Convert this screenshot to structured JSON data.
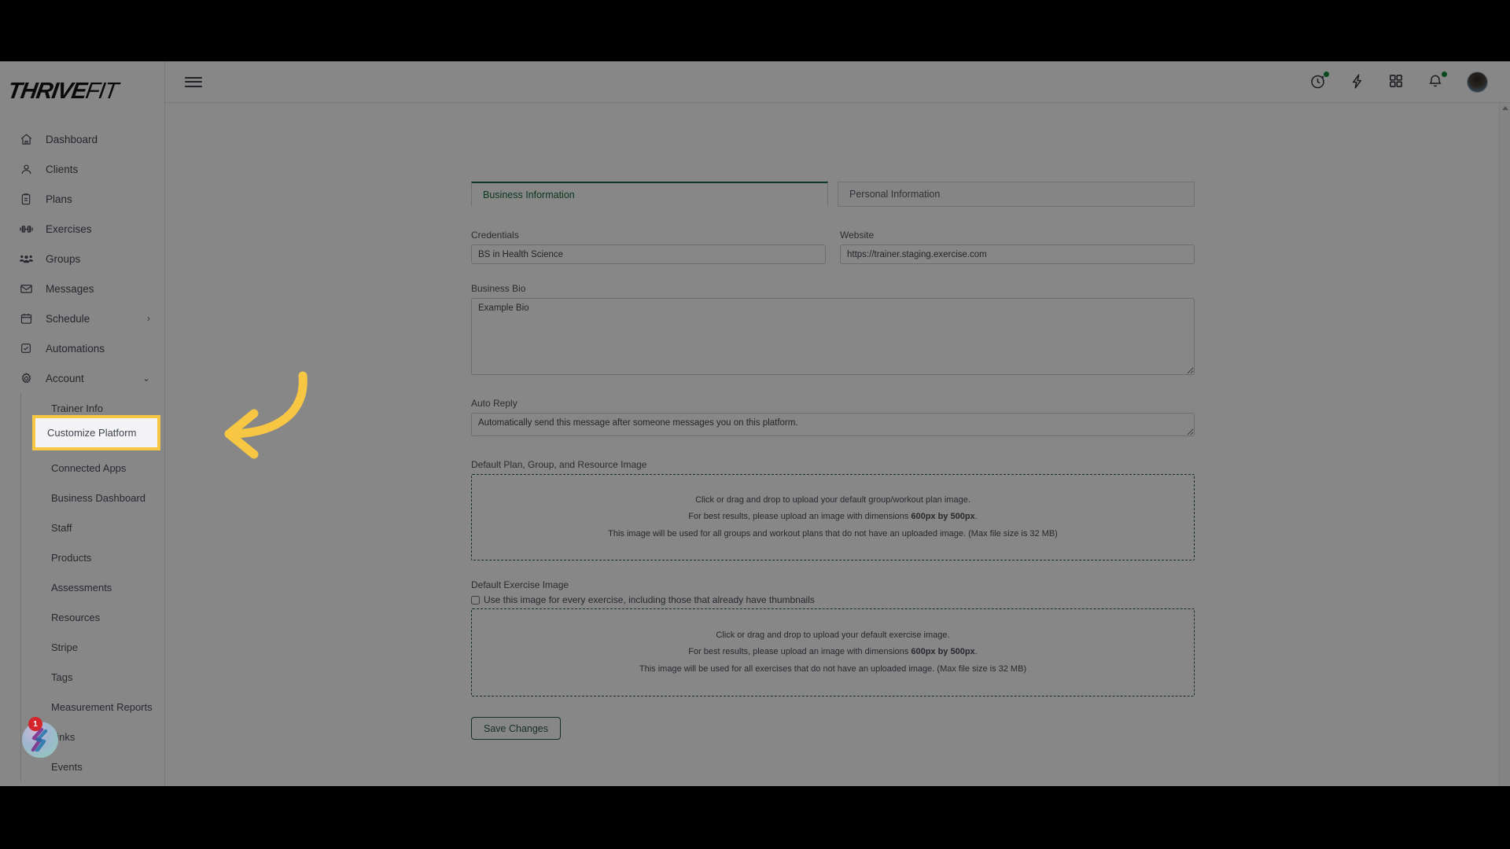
{
  "brand": {
    "name_bold": "THRIVE",
    "name_thin": "FIT"
  },
  "topbar": {
    "menu_icon": "hamburger-icon",
    "icons": [
      {
        "name": "activity-timer-icon",
        "has_dot": true
      },
      {
        "name": "lightning-bolt-icon",
        "has_dot": false
      },
      {
        "name": "apps-grid-icon",
        "has_dot": false
      },
      {
        "name": "notification-bell-icon",
        "has_dot": true
      }
    ],
    "avatar_name": "user-avatar"
  },
  "sidebar": {
    "items": [
      {
        "label": "Dashboard",
        "icon": "home-icon"
      },
      {
        "label": "Clients",
        "icon": "user-icon"
      },
      {
        "label": "Plans",
        "icon": "clipboard-icon"
      },
      {
        "label": "Exercises",
        "icon": "dumbbell-icon"
      },
      {
        "label": "Groups",
        "icon": "group-icon"
      },
      {
        "label": "Messages",
        "icon": "envelope-icon"
      },
      {
        "label": "Schedule",
        "icon": "calendar-icon",
        "chevron": "›"
      },
      {
        "label": "Automations",
        "icon": "checkbox-icon"
      },
      {
        "label": "Account",
        "icon": "gear-icon",
        "chevron": "⌄"
      }
    ],
    "account_subitems": [
      {
        "label": "Trainer Info"
      },
      {
        "label": "Customize Platform",
        "highlighted": true
      },
      {
        "label": "Connected Apps"
      },
      {
        "label": "Business Dashboard"
      },
      {
        "label": "Staff"
      },
      {
        "label": "Products"
      },
      {
        "label": "Assessments"
      },
      {
        "label": "Resources"
      },
      {
        "label": "Stripe"
      },
      {
        "label": "Tags"
      },
      {
        "label": "Measurement Reports"
      },
      {
        "label": "Links"
      },
      {
        "label": "Events"
      }
    ],
    "chat_widget": {
      "name": "chat-widget",
      "badge_count": "1"
    }
  },
  "main": {
    "tabs": [
      {
        "label": "Business Information",
        "active": true
      },
      {
        "label": "Personal Information",
        "active": false
      }
    ],
    "credentials": {
      "label": "Credentials",
      "value": "BS in Health Science",
      "placeholder": "Credentials"
    },
    "website": {
      "label": "Website",
      "value": "https://trainer.staging.exercise.com",
      "placeholder": "Website"
    },
    "business_bio": {
      "label": "Business Bio",
      "value": "Example Bio",
      "placeholder": "Business Bio"
    },
    "auto_reply": {
      "label": "Auto Reply",
      "value": "Automatically send this message after someone messages you on this platform.",
      "placeholder": "Auto Reply"
    },
    "default_plan_image": {
      "label": "Default Plan, Group, and Resource Image",
      "line1": "Click or drag and drop to upload your default group/workout plan image.",
      "line2_pre": "For best results, please upload an image with dimensions ",
      "line2_bold": "600px by 500px",
      "line2_post": ".",
      "line3": "This image will be used for all groups and workout plans that do not have an uploaded image. (Max file size is 32 MB)"
    },
    "default_exercise_image": {
      "label": "Default Exercise Image",
      "checkbox_label": "Use this image for every exercise, including those that already have thumbnails",
      "checkbox_checked": false,
      "line1": "Click or drag and drop to upload your default exercise image.",
      "line2_pre": "For best results, please upload an image with dimensions ",
      "line2_bold": "600px by 500px",
      "line2_post": ".",
      "line3": "This image will be used for all exercises that do not have an uploaded image. (Max file size is 32 MB)"
    },
    "save_button": "Save Changes"
  },
  "annotation": {
    "arrow_name": "pointer-arrow",
    "arrow_color": "#F7C744",
    "highlight_color": "#F7C744"
  }
}
